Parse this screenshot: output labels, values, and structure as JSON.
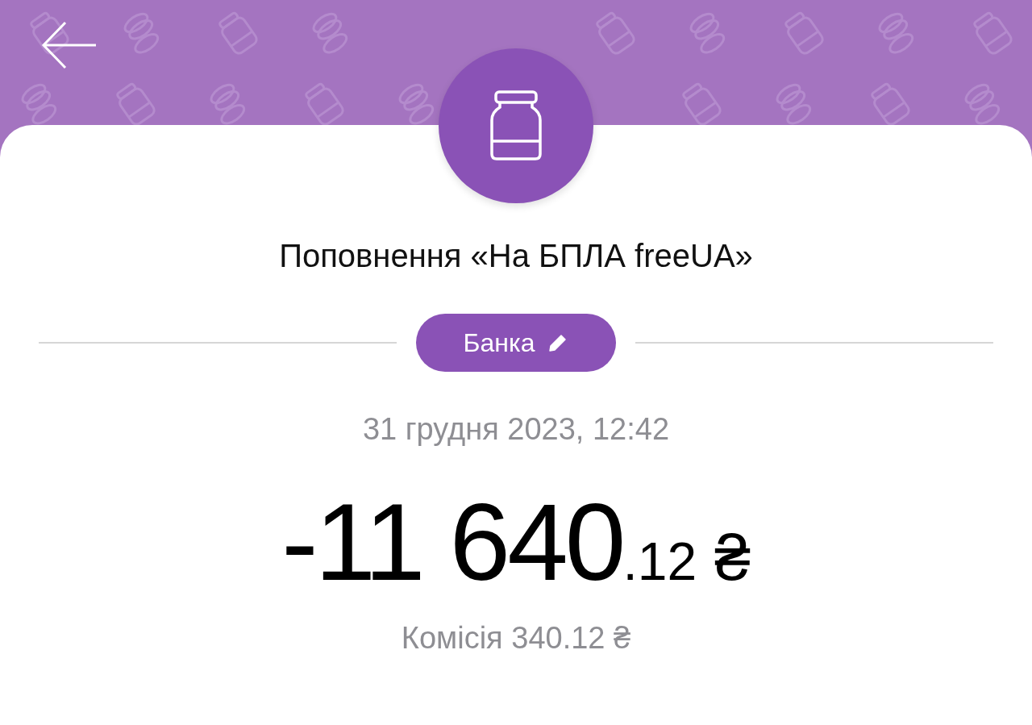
{
  "title": "Поповнення «На БПЛА freeUA»",
  "category": {
    "label": "Банка"
  },
  "date": "31 грудня 2023, 12:42",
  "amount": {
    "integer": "-11 640",
    "fraction": ".12",
    "currency": "₴"
  },
  "commission": "Комісія 340.12 ₴"
}
